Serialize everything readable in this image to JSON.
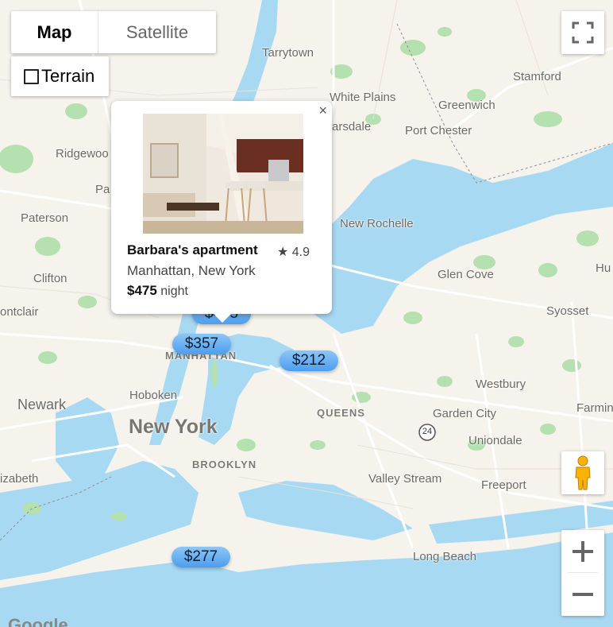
{
  "map_type": {
    "map_label": "Map",
    "satellite_label": "Satellite",
    "terrain_label": "Terrain"
  },
  "icons": {
    "fullscreen": "fullscreen-icon",
    "pegman": "pegman-icon",
    "zoom_in": "plus-icon",
    "zoom_out": "minus-icon",
    "close": "close-icon",
    "star": "star-icon"
  },
  "places": {
    "tarrytown": "Tarrytown",
    "stamford": "Stamford",
    "white_plains": "White Plains",
    "greenwich": "Greenwich",
    "scarsdale": "arsdale",
    "port_chester": "Port Chester",
    "ridgewood": "Ridgewoo",
    "paramus": "Pa",
    "paterson": "Paterson",
    "new_rochelle": "New Rochelle",
    "clifton": "Clifton",
    "glen_cove": "Glen Cove",
    "huntington": "Hu",
    "montclair": "ontclair",
    "syosset": "Syosset",
    "manhattan": "MANHATTAN",
    "hoboken": "Hoboken",
    "newark": "Newark",
    "westbury": "Westbury",
    "farmingdale": "Farmin",
    "queens": "QUEENS",
    "garden_city": "Garden City",
    "new_york": "New York",
    "uniondale": "Uniondale",
    "elizabeth": "izabeth",
    "brooklyn": "BROOKLYN",
    "valley_stream": "Valley Stream",
    "freeport": "Freeport",
    "long_beach": "Long Beach",
    "highway_24": "24",
    "google": "Google"
  },
  "markers": [
    {
      "label": "$357"
    },
    {
      "label": "$212"
    },
    {
      "label": "$277"
    },
    {
      "label": "$475"
    }
  ],
  "popup": {
    "close_glyph": "×",
    "title": "Barbara's apartment",
    "rating_star": "★",
    "rating": "4.9",
    "location": "Manhattan, New York",
    "price": "$475",
    "price_unit": "night"
  },
  "colors": {
    "water": "#a8d9f2",
    "land": "#f6f3ec",
    "park": "#b5e0b0",
    "marker": "#6aaef3"
  }
}
